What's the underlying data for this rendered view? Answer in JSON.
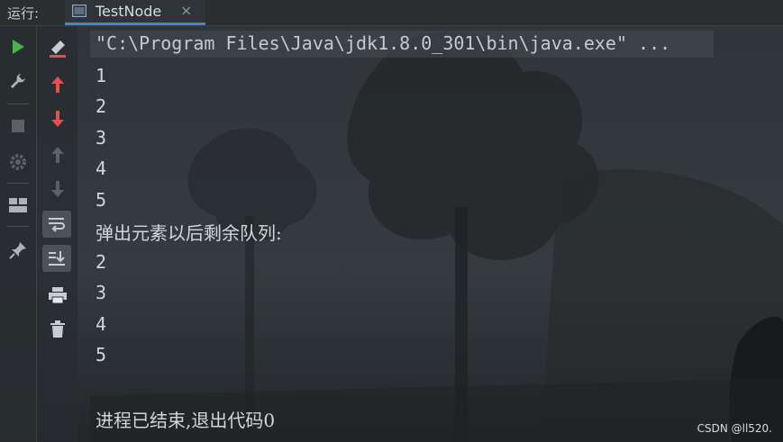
{
  "header": {
    "run_label": "运行:",
    "tab_title": "TestNode",
    "tab_close": "×"
  },
  "console": {
    "command": "\"C:\\Program Files\\Java\\jdk1.8.0_301\\bin\\java.exe\" ...",
    "lines": [
      "1",
      "2",
      "3",
      "4",
      "5",
      "弹出元素以后剩余队列:",
      "2",
      "3",
      "4",
      "5",
      "",
      "进程已结束,退出代码0"
    ]
  },
  "watermark": "CSDN @ll520.",
  "colors": {
    "run_green": "#4caf50",
    "up_red": "#e05252",
    "down_red": "#e05252",
    "tab_underline": "#4a86c7"
  },
  "icons": [
    "run-icon",
    "wrench-icon",
    "stop-icon",
    "settings-icon",
    "layout-icon",
    "pin-icon",
    "clear-icon",
    "arrow-up-icon",
    "arrow-down-icon",
    "arrow-up-disabled-icon",
    "arrow-down-disabled-icon",
    "soft-wrap-icon",
    "scroll-to-end-icon",
    "print-icon",
    "trash-icon"
  ]
}
